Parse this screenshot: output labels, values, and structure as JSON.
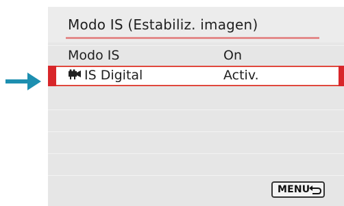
{
  "colors": {
    "accent": "#d8262a",
    "arrow": "#1d8fb0",
    "header_line": "#e38a8a",
    "panel_bg": "#e6e6e6"
  },
  "header": {
    "title": "Modo IS (Estabiliz. imagen)"
  },
  "menu": {
    "items": [
      {
        "label": "Modo IS",
        "value": "On",
        "selected": false
      },
      {
        "label": "IS Digital",
        "value": "Activ.",
        "selected": true,
        "icon": "movie-icon"
      }
    ]
  },
  "footer": {
    "menu_button_label": "MENU",
    "back_icon": "back-arrow-icon"
  },
  "indicator": {
    "icon": "pointer-arrow-icon"
  }
}
